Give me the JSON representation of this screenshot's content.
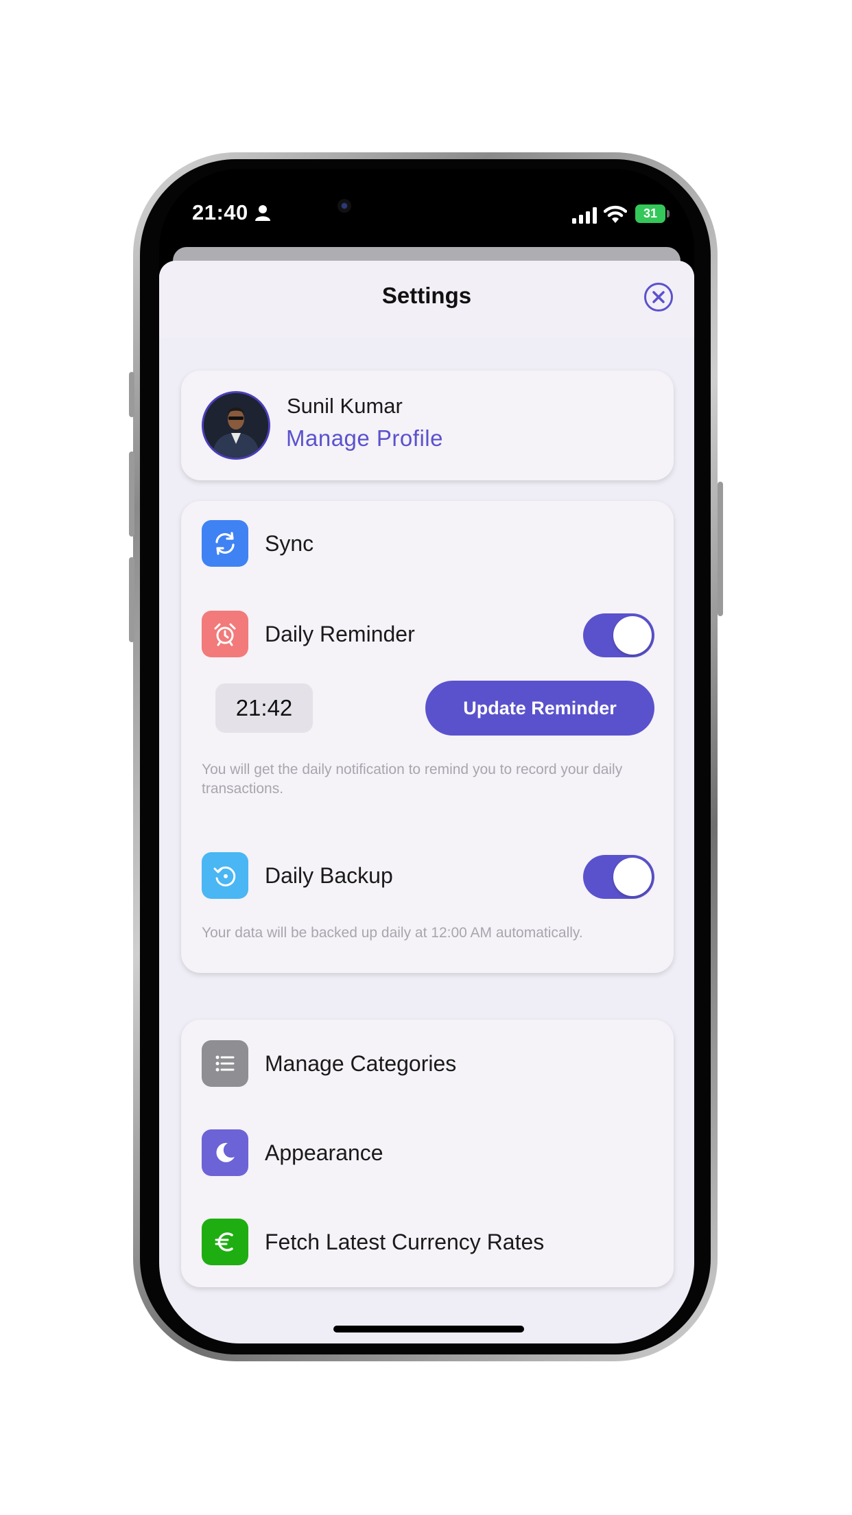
{
  "status_bar": {
    "time": "21:40",
    "battery": "31",
    "icons": [
      "person-icon",
      "signal-icon",
      "wifi-icon",
      "battery-icon"
    ]
  },
  "header": {
    "title": "Settings",
    "close_icon": "close-icon"
  },
  "profile": {
    "name": "Sunil Kumar",
    "link_label": "Manage Profile"
  },
  "sync_section": {
    "sync_label": "Sync",
    "reminder": {
      "label": "Daily Reminder",
      "enabled": true,
      "time": "21:42",
      "update_label": "Update Reminder",
      "hint": "You will get the daily notification to remind you to record your daily transactions."
    },
    "backup": {
      "label": "Daily Backup",
      "enabled": true,
      "hint": "Your data will be backed up daily at 12:00 AM automatically."
    }
  },
  "more_section": {
    "items": [
      {
        "label": "Manage Categories",
        "icon": "list-icon"
      },
      {
        "label": "Appearance",
        "icon": "moon-icon"
      },
      {
        "label": "Fetch Latest Currency Rates",
        "icon": "euro-icon"
      }
    ]
  },
  "colors": {
    "accent": "#5a52cc",
    "sync_icon_bg": "#3f82f3",
    "reminder_icon_bg": "#f27a7a",
    "backup_icon_bg": "#4ab6f3",
    "categories_icon_bg": "#8e8e93",
    "appearance_icon_bg": "#6c63d6",
    "currency_icon_bg": "#1fae12"
  }
}
